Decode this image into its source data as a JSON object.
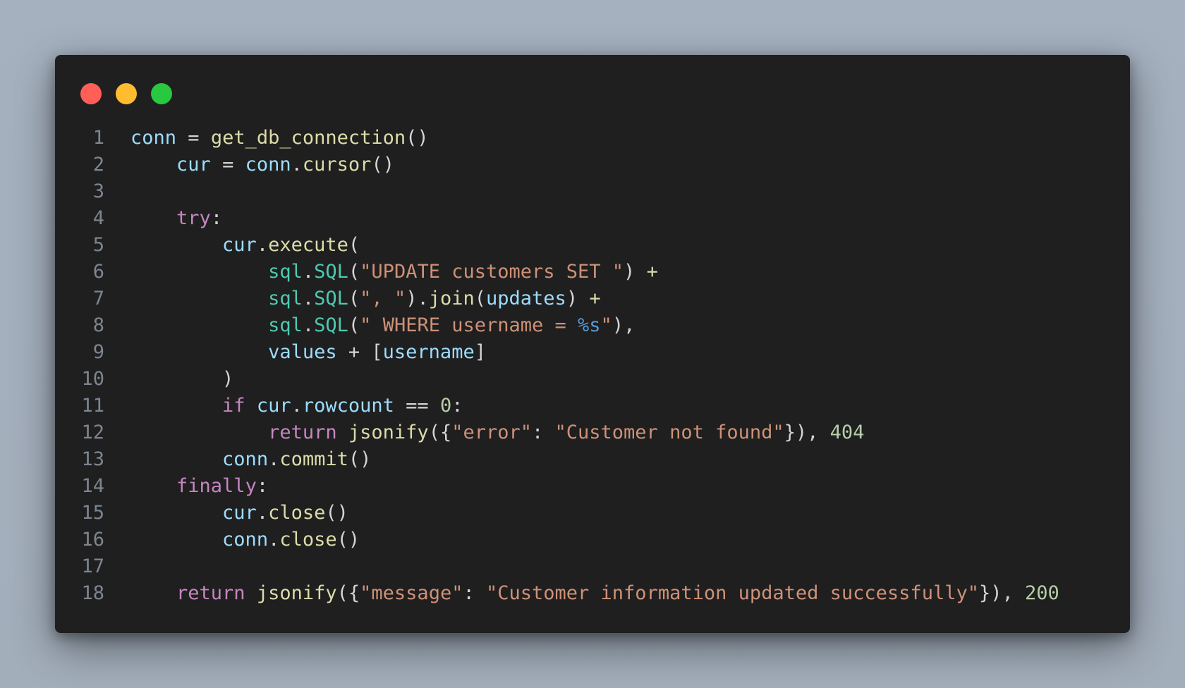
{
  "window": {
    "dot_colors": [
      "#ff5f57",
      "#febc2e",
      "#28c840"
    ]
  },
  "theme": {
    "default": "#d4d4d4",
    "var": "#9cdcfe",
    "func": "#dcdcaa",
    "kw": "#c586c0",
    "str": "#ce9178",
    "num": "#b5cea8",
    "cls": "#4ec9b0",
    "fmt": "#569cd6",
    "lineno": "#7d8590"
  },
  "code": {
    "lines": [
      {
        "n": "1",
        "tokens": [
          [
            "conn",
            "var"
          ],
          [
            " = ",
            "default"
          ],
          [
            "get_db_connection",
            "func"
          ],
          [
            "()",
            "default"
          ]
        ]
      },
      {
        "n": "2",
        "tokens": [
          [
            "    ",
            "default"
          ],
          [
            "cur",
            "var"
          ],
          [
            " = ",
            "default"
          ],
          [
            "conn",
            "var"
          ],
          [
            ".",
            "default"
          ],
          [
            "cursor",
            "func"
          ],
          [
            "()",
            "default"
          ]
        ]
      },
      {
        "n": "3",
        "tokens": []
      },
      {
        "n": "4",
        "tokens": [
          [
            "    ",
            "default"
          ],
          [
            "try",
            "kw"
          ],
          [
            ":",
            "default"
          ]
        ]
      },
      {
        "n": "5",
        "tokens": [
          [
            "        ",
            "default"
          ],
          [
            "cur",
            "var"
          ],
          [
            ".",
            "default"
          ],
          [
            "execute",
            "func"
          ],
          [
            "(",
            "default"
          ]
        ]
      },
      {
        "n": "6",
        "tokens": [
          [
            "            ",
            "default"
          ],
          [
            "sql",
            "cls"
          ],
          [
            ".",
            "default"
          ],
          [
            "SQL",
            "cls"
          ],
          [
            "(",
            "default"
          ],
          [
            "\"UPDATE customers SET \"",
            "str"
          ],
          [
            ") ",
            "default"
          ],
          [
            "+",
            "func"
          ]
        ]
      },
      {
        "n": "7",
        "tokens": [
          [
            "            ",
            "default"
          ],
          [
            "sql",
            "cls"
          ],
          [
            ".",
            "default"
          ],
          [
            "SQL",
            "cls"
          ],
          [
            "(",
            "default"
          ],
          [
            "\", \"",
            "str"
          ],
          [
            ").",
            "default"
          ],
          [
            "join",
            "func"
          ],
          [
            "(",
            "default"
          ],
          [
            "updates",
            "var"
          ],
          [
            ") ",
            "default"
          ],
          [
            "+",
            "func"
          ]
        ]
      },
      {
        "n": "8",
        "tokens": [
          [
            "            ",
            "default"
          ],
          [
            "sql",
            "cls"
          ],
          [
            ".",
            "default"
          ],
          [
            "SQL",
            "cls"
          ],
          [
            "(",
            "default"
          ],
          [
            "\" WHERE username = ",
            "str"
          ],
          [
            "%s",
            "fmt"
          ],
          [
            "\"",
            "str"
          ],
          [
            "),",
            "default"
          ]
        ]
      },
      {
        "n": "9",
        "tokens": [
          [
            "            ",
            "default"
          ],
          [
            "values",
            "var"
          ],
          [
            " + [",
            "default"
          ],
          [
            "username",
            "var"
          ],
          [
            "]",
            "default"
          ]
        ]
      },
      {
        "n": "10",
        "tokens": [
          [
            "        )",
            "default"
          ]
        ]
      },
      {
        "n": "11",
        "tokens": [
          [
            "        ",
            "default"
          ],
          [
            "if",
            "kw"
          ],
          [
            " ",
            "default"
          ],
          [
            "cur",
            "var"
          ],
          [
            ".",
            "default"
          ],
          [
            "rowcount",
            "var"
          ],
          [
            " == ",
            "default"
          ],
          [
            "0",
            "num"
          ],
          [
            ":",
            "default"
          ]
        ]
      },
      {
        "n": "12",
        "tokens": [
          [
            "            ",
            "default"
          ],
          [
            "return",
            "kw"
          ],
          [
            " ",
            "default"
          ],
          [
            "jsonify",
            "func"
          ],
          [
            "({",
            "default"
          ],
          [
            "\"error\"",
            "str"
          ],
          [
            ": ",
            "default"
          ],
          [
            "\"Customer not found\"",
            "str"
          ],
          [
            "}), ",
            "default"
          ],
          [
            "404",
            "num"
          ]
        ]
      },
      {
        "n": "13",
        "tokens": [
          [
            "        ",
            "default"
          ],
          [
            "conn",
            "var"
          ],
          [
            ".",
            "default"
          ],
          [
            "commit",
            "func"
          ],
          [
            "()",
            "default"
          ]
        ]
      },
      {
        "n": "14",
        "tokens": [
          [
            "    ",
            "default"
          ],
          [
            "finally",
            "kw"
          ],
          [
            ":",
            "default"
          ]
        ]
      },
      {
        "n": "15",
        "tokens": [
          [
            "        ",
            "default"
          ],
          [
            "cur",
            "var"
          ],
          [
            ".",
            "default"
          ],
          [
            "close",
            "func"
          ],
          [
            "()",
            "default"
          ]
        ]
      },
      {
        "n": "16",
        "tokens": [
          [
            "        ",
            "default"
          ],
          [
            "conn",
            "var"
          ],
          [
            ".",
            "default"
          ],
          [
            "close",
            "func"
          ],
          [
            "()",
            "default"
          ]
        ]
      },
      {
        "n": "17",
        "tokens": []
      },
      {
        "n": "18",
        "tokens": [
          [
            "    ",
            "default"
          ],
          [
            "return",
            "kw"
          ],
          [
            " ",
            "default"
          ],
          [
            "jsonify",
            "func"
          ],
          [
            "({",
            "default"
          ],
          [
            "\"message\"",
            "str"
          ],
          [
            ": ",
            "default"
          ],
          [
            "\"Customer information updated successfully\"",
            "str"
          ],
          [
            "}), ",
            "default"
          ],
          [
            "200",
            "num"
          ]
        ]
      }
    ]
  }
}
